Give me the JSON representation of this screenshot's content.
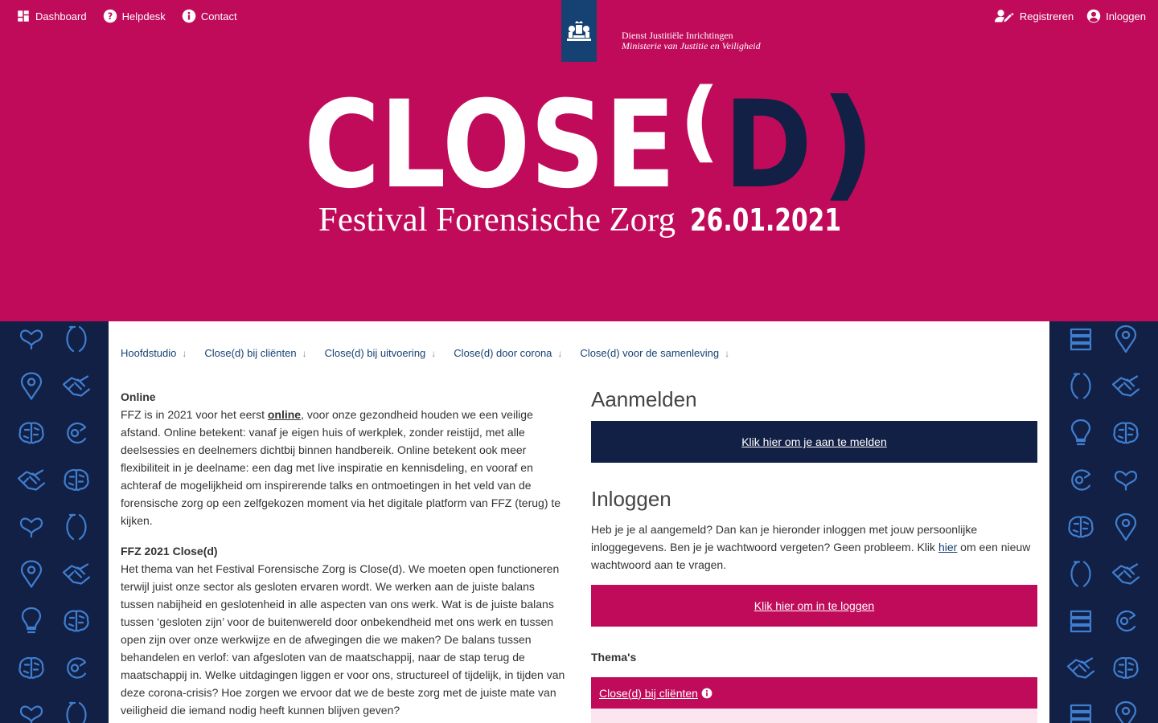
{
  "topnav": {
    "left": [
      {
        "label": "Dashboard",
        "icon": "dashboard-icon"
      },
      {
        "label": "Helpdesk",
        "icon": "help-circle-icon"
      },
      {
        "label": "Contact",
        "icon": "info-circle-icon"
      }
    ],
    "right": [
      {
        "label": "Registreren",
        "icon": "user-edit-icon"
      },
      {
        "label": "Inloggen",
        "icon": "user-circle-icon"
      }
    ]
  },
  "brand": {
    "org_line1": "Dienst Justitiële Inrichtingen",
    "org_line2": "Ministerie van Justitie en Veiligheid",
    "logo_word": "CLOSE",
    "logo_paren_open": "(",
    "logo_d": "D",
    "logo_paren_close": ")",
    "festival_name": "Festival Forensische Zorg",
    "festival_date": "26.01.2021"
  },
  "colors": {
    "accent_pink": "#c00b5a",
    "navy": "#132046",
    "rijk_blue": "#154273",
    "pattern_icon": "#3f7fd0"
  },
  "subnav": [
    "Hoofdstudio",
    "Close(d) bij cliënten",
    "Close(d) bij uitvoering",
    "Close(d) door corona",
    "Close(d) voor de samenleving"
  ],
  "content": {
    "online_heading": "Online",
    "online_text_before": "FFZ is in 2021 voor het eerst ",
    "online_link": "online",
    "online_text_after": ", voor onze gezondheid houden we een veilige afstand. Online betekent: vanaf je eigen huis of werkplek, zonder reistijd, met alle deelsessies en deelnemers dichtbij binnen handbereik. Online betekent ook meer flexibiliteit in je deelname: een dag met live inspiratie en kennisdeling, en vooraf en achteraf de mogelijkheid om inspirerende talks en ontmoetingen in het veld van de forensische zorg op een zelfgekozen moment via het digitale platform van FFZ (terug) te kijken.",
    "theme_heading": "FFZ 2021 Close(d)",
    "theme_text": "Het thema van het Festival Forensische Zorg is Close(d). We moeten open functioneren terwijl juist onze sector als gesloten ervaren wordt. We werken aan de juiste balans tussen nabijheid en geslotenheid in alle aspecten van ons werk. Wat is de juiste balans tussen ‘gesloten zijn’ voor de buitenwereld door onbekendheid met ons werk en tussen open zijn over onze werkwijze en de afwegingen die we maken? De balans tussen behandelen en verlof: van afgesloten van de maatschappij, naar de stap terug de maatschappij in. Welke uitdagingen liggen er voor ons, structureel of tijdelijk, in tijden van deze corona-crisis? Hoe zorgen we ervoor dat we de beste zorg met de juiste mate van veiligheid die iemand nodig heeft kunnen blijven geven?"
  },
  "sidebar": {
    "register_heading": "Aanmelden",
    "register_button": "Klik hier om je aan te melden",
    "login_heading": "Inloggen",
    "login_text_before": "Heb je je al aangemeld? Dan kan je hieronder inloggen met jouw persoonlijke inloggegevens. Ben je je wachtwoord vergeten? Geen probleem. Klik ",
    "login_link": "hier",
    "login_text_after": " om een nieuw wachtwoord aan te vragen.",
    "login_button": "Klik hier om in te loggen",
    "themes_label": "Thema's",
    "themes": [
      "Close(d) bij cliënten"
    ]
  },
  "patterns": {
    "left": [
      [
        "heart-icon",
        "parenthesis-icon"
      ],
      [
        "location-pin-icon",
        "handshake-icon"
      ],
      [
        "brain-icon",
        "c-arrow-icon"
      ],
      [
        "handshake-icon",
        "brain-icon"
      ],
      [
        "heart-icon",
        "parenthesis-icon"
      ],
      [
        "location-pin-icon",
        "handshake-icon"
      ],
      [
        "lightbulb-icon",
        "brain-icon"
      ],
      [
        "brain-icon",
        "c-arrow-icon"
      ],
      [
        "heart-icon",
        "parenthesis-icon"
      ]
    ],
    "right": [
      [
        "stack-icon",
        "location-pin-icon"
      ],
      [
        "parenthesis-icon",
        "handshake-icon"
      ],
      [
        "lightbulb-icon",
        "brain-icon"
      ],
      [
        "c-arrow-icon",
        "heart-icon"
      ],
      [
        "brain-icon",
        "location-pin-icon"
      ],
      [
        "parenthesis-icon",
        "handshake-icon"
      ],
      [
        "stack-icon",
        "c-arrow-icon"
      ],
      [
        "handshake-icon",
        "brain-icon"
      ],
      [
        "stack-icon",
        "location-pin-icon"
      ]
    ]
  }
}
